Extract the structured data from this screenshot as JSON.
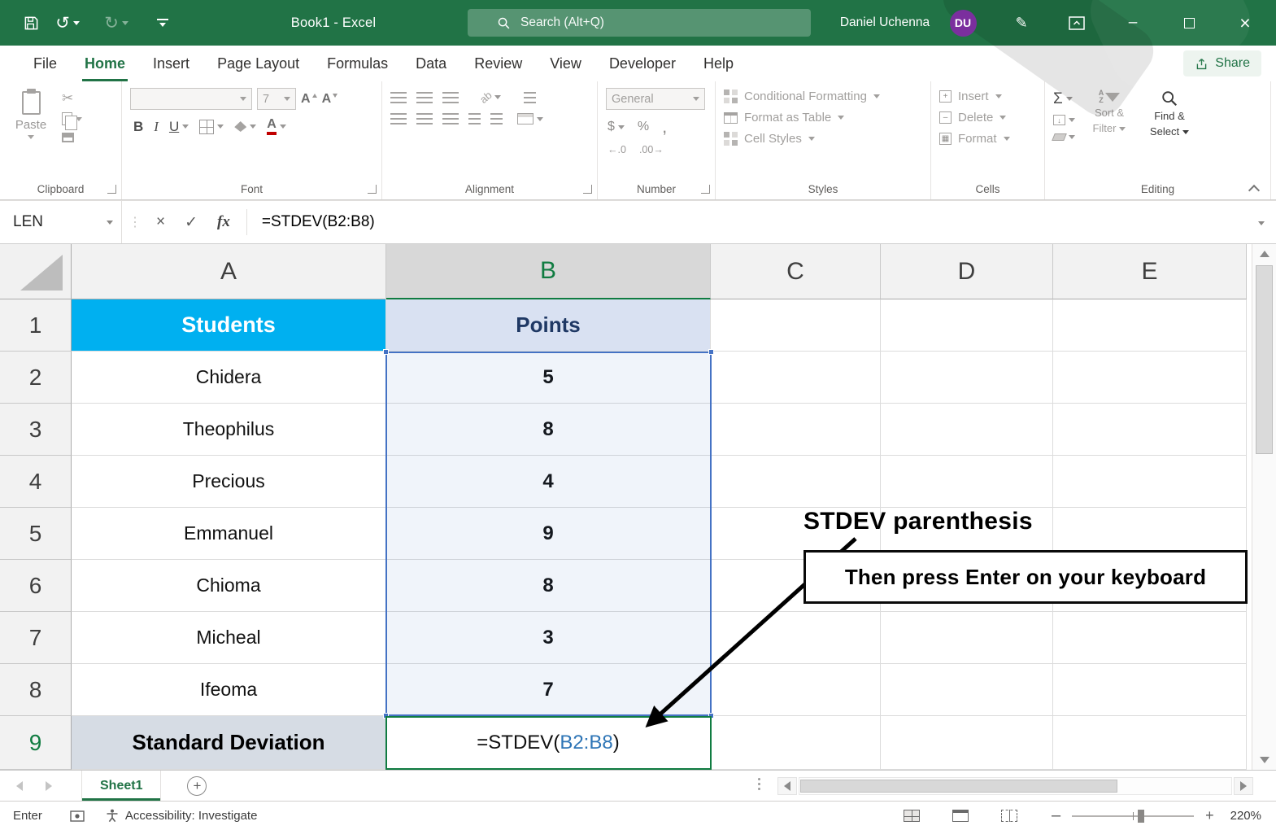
{
  "titlebar": {
    "title": "Book1 - Excel",
    "search_placeholder": "Search (Alt+Q)",
    "user_name": "Daniel Uchenna",
    "user_initials": "DU",
    "minimize": "–",
    "close": "×"
  },
  "ribbon_tabs": {
    "items": [
      "File",
      "Home",
      "Insert",
      "Page Layout",
      "Formulas",
      "Data",
      "Review",
      "View",
      "Developer",
      "Help"
    ],
    "active": "Home",
    "share_label": "Share"
  },
  "ribbon": {
    "clipboard": {
      "group_label": "Clipboard",
      "paste_label": "Paste"
    },
    "font": {
      "group_label": "Font",
      "font_name": "",
      "font_size": "7",
      "bold": "B",
      "italic": "I",
      "underline": "U",
      "grow": "A",
      "shrink": "A"
    },
    "alignment": {
      "group_label": "Alignment",
      "orientation": "ab"
    },
    "number": {
      "group_label": "Number",
      "format": "General",
      "currency": "$",
      "percent": "%",
      "comma": ",",
      "increase_decimal": "←.0",
      "decrease_decimal": ".00→"
    },
    "styles": {
      "group_label": "Styles",
      "conditional_formatting": "Conditional Formatting",
      "format_as_table": "Format as Table",
      "cell_styles": "Cell Styles"
    },
    "cells": {
      "group_label": "Cells",
      "insert": "Insert",
      "delete": "Delete",
      "format": "Format",
      "insert_glyph": "+",
      "delete_glyph": "–",
      "format_glyph": "▦"
    },
    "editing": {
      "group_label": "Editing",
      "autosum": "Σ",
      "fill_glyph": "↓",
      "sort_a": "A",
      "sort_z": "Z",
      "sort_filter_line1": "Sort &",
      "sort_filter_line2": "Filter",
      "find_select_line1": "Find &",
      "find_select_line2": "Select"
    }
  },
  "formula_bar": {
    "name_box": "LEN",
    "cancel": "×",
    "enter": "✓",
    "fx": "fx",
    "formula": "=STDEV(B2:B8)"
  },
  "grid": {
    "col_headers": [
      "A",
      "B",
      "C",
      "D",
      "E"
    ],
    "rows": [
      {
        "n": "1",
        "a": "Students",
        "b": "Points"
      },
      {
        "n": "2",
        "a": "Chidera",
        "b": "5"
      },
      {
        "n": "3",
        "a": "Theophilus",
        "b": "8"
      },
      {
        "n": "4",
        "a": "Precious",
        "b": "4"
      },
      {
        "n": "5",
        "a": "Emmanuel",
        "b": "9"
      },
      {
        "n": "6",
        "a": "Chioma",
        "b": "8"
      },
      {
        "n": "7",
        "a": "Micheal",
        "b": "3"
      },
      {
        "n": "8",
        "a": "Ifeoma",
        "b": "7"
      },
      {
        "n": "9",
        "a": "Standard Deviation"
      }
    ],
    "selected_column": "B",
    "selected_range": "B2:B8",
    "active_cell": "B9",
    "active_cell_formula": {
      "prefix": "=STDEV(",
      "range_ref": "B2:B8",
      "suffix": ")"
    }
  },
  "annotation": {
    "heading": "STDEV parenthesis",
    "callout": "Then press Enter on your keyboard"
  },
  "sheet_tabs": {
    "active_sheet": "Sheet1",
    "add_sheet": "+"
  },
  "status_bar": {
    "mode": "Enter",
    "accessibility": "Accessibility: Investigate",
    "zoom_out": "–",
    "zoom_in": "+",
    "zoom_level": "220%"
  },
  "colors": {
    "title_green": "#217346",
    "active_green": "#107C41",
    "students_fill": "#00B0F0",
    "points_fill": "#D9E1F2",
    "range_blue": "#4472C4",
    "label_fill": "#D6DCE4",
    "avatar_purple": "#7B2F9E"
  }
}
